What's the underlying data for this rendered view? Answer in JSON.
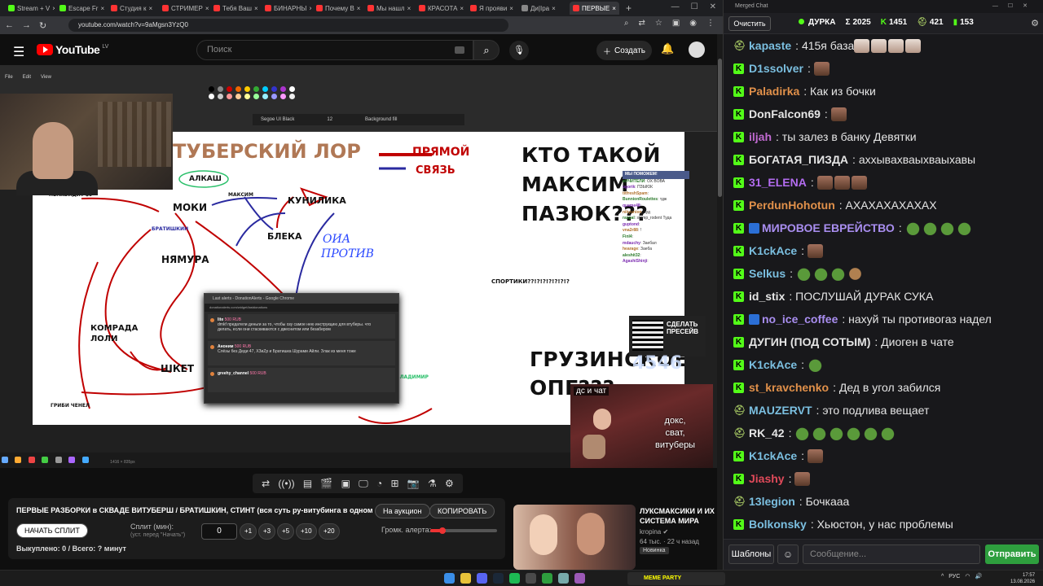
{
  "browser": {
    "tabs": [
      {
        "label": "Stream + V",
        "color": "#53fc18"
      },
      {
        "label": "Escape Fr",
        "color": "#53fc18"
      },
      {
        "label": "Студия к",
        "color": "#ff3333"
      },
      {
        "label": "СТРИМЕР",
        "color": "#ff3333"
      },
      {
        "label": "Тебя Ваш",
        "color": "#ff3333"
      },
      {
        "label": "БИНАРНЫ",
        "color": "#ff3333"
      },
      {
        "label": "Почему В",
        "color": "#ff3333"
      },
      {
        "label": "Мы нашл",
        "color": "#ff3333"
      },
      {
        "label": "КРАСОТА",
        "color": "#ff3333"
      },
      {
        "label": "Я прояви",
        "color": "#ff3333"
      },
      {
        "label": "Ди|Іра",
        "color": "#888888"
      },
      {
        "label": "ПЕРВЫЕ",
        "color": "#ff3333",
        "active": true
      }
    ],
    "url": "youtube.com/watch?v=9aMgsn3YzQ0"
  },
  "youtube": {
    "logo_text": "YouTube",
    "region": "LV",
    "search_placeholder": "Поиск",
    "create_label": "Создать"
  },
  "video": {
    "paint_menu": [
      "File",
      "Edit",
      "View"
    ],
    "font_name": "Segoe UI Black",
    "font_size": "12",
    "background_fill": "Background fill",
    "canvas": {
      "lor_title": "ТУБЕРСКИЙ ЛОР",
      "legend_direct": "ПРЯМОЙ",
      "legend_link": "СВЯЗЬ",
      "question1": "КТО ТАКОЙ",
      "question2": "МАКСИМ",
      "question3": "ПАЗЮК???",
      "gruzinsky1": "ГРУЗИНСКОЕ",
      "gruzinsky2": "ОПГ???",
      "sportiki": "СПОРТИКИ??!?!?!?!?!?!?",
      "nodes": {
        "alkash": "АЛКАШ",
        "moki": "МОКИ",
        "kunilika": "КУНИЛИКА",
        "bleka": "БЛЕКА",
        "nyamura": "НЯМУРА",
        "komrada1": "КОМРАДА",
        "komrada2": "ЛОЛИ",
        "shket": "ШКЕТ",
        "nenavidit": "НЕНАВИДИТ $9",
        "maksim": "МАКСИМ",
        "bratishkin": "БРАТИШКИН",
        "gribi": "ГРИБИ ЧЕНЕЛ",
        "oia": "ОИА",
        "protiv": "ПРОТИВ",
        "vladimir": "ВЛАДИМИР"
      }
    },
    "donation": {
      "title": "Last alerts - DonationAlerts - Google Chrome",
      "url": "donationalerts.com/widget/lastdonations",
      "messages": [
        {
          "name": "lite",
          "amount": "500 RUB",
          "text": "dmkf предатели деньги за то, чтобы озу самое нею инструкцию для втуберы. что делать, если они стаскиваются с двеснитом или безабером"
        },
        {
          "name": "Аноним",
          "amount": "500 RUB",
          "text": "Слёзы без Деди 47, ХЗиZр и Братишка Шурами Айли. Злак из меня тоже"
        },
        {
          "name": "greehy_channel",
          "amount": "500 RUB",
          "text": ""
        }
      ]
    },
    "overlay_chat": {
      "header": "МЫ ПОМОЖЕМ!",
      "lines": [
        {
          "user": "вИЧИТЕЛИ",
          "text": "ОХ ВОВА"
        },
        {
          "user": "ugorik",
          "text": "ПЗЫЮК"
        },
        {
          "user": "titfreshSpam",
          "text": ""
        },
        {
          "user": "BunnionRoulettes",
          "text": "тдж"
        },
        {
          "user": "quame48",
          "text": ""
        },
        {
          "user": "nikyunion",
          "text": "зуд"
        },
        {
          "user": "raspal",
          "text": "stamp_rodent Туда"
        },
        {
          "user": "guptond",
          "text": ""
        },
        {
          "user": "vna2r88",
          "text": "!"
        },
        {
          "user": "FinI4",
          "text": ""
        },
        {
          "user": "mdauchy",
          "text": "Заебал"
        },
        {
          "user": "hearage",
          "text": "Заеба"
        },
        {
          "user": "aleshit32",
          "text": ""
        },
        {
          "user": "AgashiShinji",
          "text": ""
        }
      ]
    },
    "qr_text_1": "СДЕЛАТЬ",
    "qr_text_2": "ПРЕСЕЙВ",
    "counter": "4546",
    "ds_label": "дс и чат",
    "ds_caption": [
      "докс,",
      "сват,",
      "витуберы"
    ],
    "taskbar_text": "1416 × 835px"
  },
  "player_controls": [
    "repeat-icon",
    "radio-icon",
    "subtitles-icon",
    "clapper-icon",
    "picture-icon",
    "monitor-icon",
    "speed-icon",
    "plus-screen-icon",
    "camera-icon",
    "lab-icon",
    "gear-icon"
  ],
  "panel": {
    "title": "ПЕРВЫЕ РАЗБОРКИ в СКВАДЕ ВИТУБЕРШ / БРАТИШКИН, СТИНТ (вся суть ру-витубинга в одном видео)",
    "auction_btn": "На аукцион",
    "copy_btn": "КОПИРОВАТЬ",
    "start_btn": "НАЧАТЬ СПЛИТ",
    "timer_label": "Сплит (мин):",
    "timer_sub": "(уст. перед \"Начать\")",
    "timer_value": "0",
    "increments": [
      "+1",
      "+3",
      "+5",
      "+10",
      "+20"
    ],
    "volume_label": "Громк. алерта:",
    "volume_fraction": 0.18,
    "status": "Выкуплено: 0 / Всего: ? минут"
  },
  "recommendation": {
    "title": "ЛУКСМАКСИКИ И ИХ СИСТЕМА МИРА",
    "channel": "kropina",
    "views": "64 тыс.",
    "ago": "22 ч назад",
    "badge": "Новинка",
    "meme": "MEME PARTY"
  },
  "taskbar": {
    "meme_bar": "MEME PARTY",
    "lang": "РУС",
    "time": "17:57",
    "date": "13.08.2026"
  },
  "chat": {
    "window_title": "Merged Chat",
    "clear_btn": "Очистить",
    "stats": {
      "status": "ДУРКА",
      "total": "2025",
      "kick": "1451",
      "twitch": "421",
      "other": "153"
    },
    "messages": [
      {
        "platform": "twitch",
        "user": "kapaste",
        "color": "#7bbfe0",
        "text": "415я база",
        "emotes": [
          "light",
          "light",
          "light",
          "light"
        ]
      },
      {
        "platform": "kick",
        "user": "D1ssolver",
        "color": "#7bbfe0",
        "text": "",
        "emotes": [
          "face"
        ]
      },
      {
        "platform": "kick",
        "user": "Paladirka",
        "color": "#e0904a",
        "text": "Как из бочки",
        "emotes": []
      },
      {
        "platform": "kick",
        "user": "DonFalcon69",
        "color": "#e5e5e5",
        "text": "",
        "emotes": [
          "face"
        ]
      },
      {
        "platform": "kick",
        "user": "iljah",
        "color": "#c06ad0",
        "text": "ты залез в банку Девятки",
        "emotes": []
      },
      {
        "platform": "kick",
        "user": "БОГАТАЯ_ПИЗДА",
        "color": "#e5e5e5",
        "text": "аххывахваыхваыхавы",
        "emotes": []
      },
      {
        "platform": "kick",
        "user": "31_ELENA",
        "color": "#b36cf0",
        "text": "",
        "emotes": [
          "face",
          "face",
          "face"
        ]
      },
      {
        "platform": "kick",
        "user": "PerdunHohotun",
        "color": "#e0904a",
        "text": "АХАХАХАХАХАХ",
        "emotes": []
      },
      {
        "platform": "kick",
        "user": "МИРОВОЕ ЕВРЕЙСТВО",
        "color": "#a98ef0",
        "badge": true,
        "text": "",
        "emotes": [
          "frog",
          "frog",
          "frog",
          "frog"
        ]
      },
      {
        "platform": "kick",
        "user": "K1ckAce",
        "color": "#7bbfe0",
        "text": "",
        "emotes": [
          "face"
        ]
      },
      {
        "platform": "kick",
        "user": "Selkus",
        "color": "#7bbfe0",
        "text": "",
        "emotes": [
          "frog",
          "frog",
          "frog",
          "burger"
        ]
      },
      {
        "platform": "kick",
        "user": "id_stix",
        "color": "#e5e5e5",
        "text": "ПОСЛУШАЙ ДУРАК СУКА",
        "emotes": []
      },
      {
        "platform": "kick",
        "user": "no_ice_coffee",
        "color": "#a98ef0",
        "badge": true,
        "text": "нахуй ты противогаз надел",
        "emotes": []
      },
      {
        "platform": "kick",
        "user": "ДУГИН (ПОД СОТЫМ)",
        "color": "#e5e5e5",
        "text": "Диоген в чате",
        "emotes": []
      },
      {
        "platform": "kick",
        "user": "K1ckAce",
        "color": "#7bbfe0",
        "text": "",
        "emotes": [
          "frog"
        ]
      },
      {
        "platform": "kick",
        "user": "st_kravchenko",
        "color": "#e0904a",
        "text": "Дед в угол забился",
        "emotes": []
      },
      {
        "platform": "twitch",
        "user": "MAUZERVT",
        "color": "#7bbfe0",
        "text": "это подлива вещает",
        "emotes": []
      },
      {
        "platform": "twitch",
        "user": "RK_42",
        "color": "#e5e5e5",
        "text": "",
        "emotes": [
          "frog",
          "frog",
          "frog",
          "frog",
          "frog",
          "frog"
        ]
      },
      {
        "platform": "kick",
        "user": "K1ckAce",
        "color": "#7bbfe0",
        "text": "",
        "emotes": [
          "face"
        ]
      },
      {
        "platform": "kick",
        "user": "Jiashy",
        "color": "#e04a5a",
        "text": "",
        "emotes": [
          "face"
        ]
      },
      {
        "platform": "twitch",
        "user": "13legion",
        "color": "#7bbfe0",
        "text": "Бочкааа",
        "emotes": []
      },
      {
        "platform": "kick",
        "user": "Bolkonsky",
        "color": "#7bbfe0",
        "text": "Хьюстон, у нас проблемы",
        "emotes": []
      }
    ],
    "templates_btn": "Шаблоны",
    "input_placeholder": "Сообщение...",
    "send_btn": "Отправить"
  },
  "colors": {
    "kick_green": "#53fc18",
    "youtube_red": "#ff0000",
    "send_green": "#2e9e3e"
  }
}
